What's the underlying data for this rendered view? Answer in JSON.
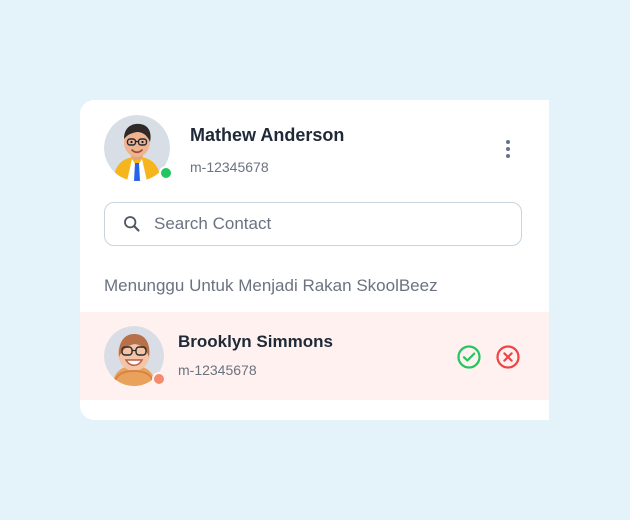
{
  "user": {
    "name": "Mathew Anderson",
    "id": "m-12345678",
    "status": "online",
    "status_color": "#22c55e"
  },
  "search": {
    "placeholder": "Search Contact",
    "value": ""
  },
  "section": {
    "title": "Menunggu Untuk Menjadi Rakan SkoolBeez"
  },
  "pending_contacts": [
    {
      "name": "Brooklyn Simmons",
      "id": "m-12345678",
      "status_color": "#f38b6f",
      "actions": [
        "check-circle-icon",
        "x-circle-icon"
      ]
    }
  ],
  "icons": {
    "menu": "vertical-dots-icon",
    "search": "search-icon",
    "accept": "check-circle-icon",
    "reject": "x-circle-icon"
  },
  "colors": {
    "background": "#e4f2fa",
    "panel": "#ffffff",
    "row_highlight": "#fff1ef",
    "accept": "#22c55e",
    "reject": "#ef4444"
  }
}
